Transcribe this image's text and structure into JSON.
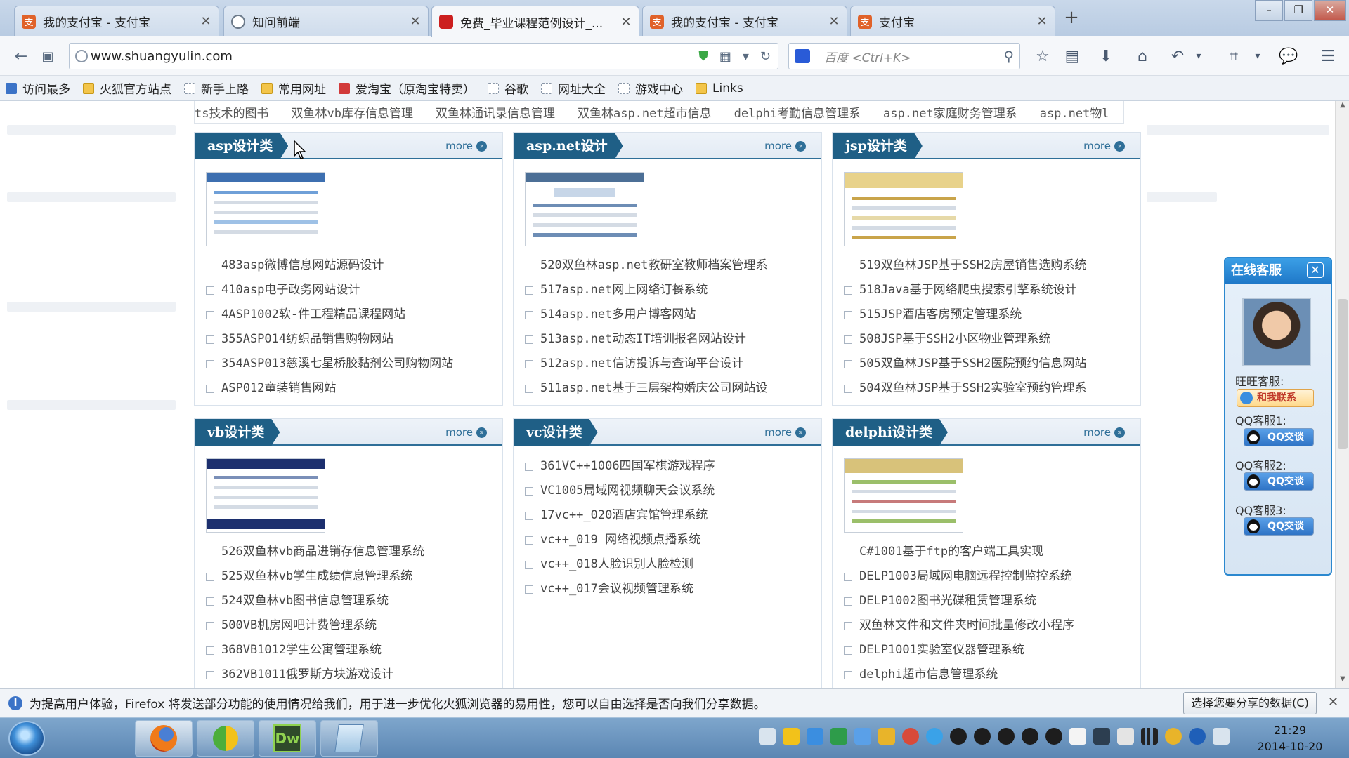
{
  "tabs": [
    {
      "title": "我的支付宝 - 支付宝",
      "icon": "alipay-icon",
      "color": "#e0622a"
    },
    {
      "title": "知问前端",
      "icon": "clock-icon",
      "color": "#6c7a8a"
    },
    {
      "title": "免费_毕业课程范例设计_...",
      "icon": "site-icon",
      "color": "#cc1f1f"
    },
    {
      "title": "我的支付宝 - 支付宝",
      "icon": "alipay-icon",
      "color": "#e0622a"
    },
    {
      "title": "支付宝",
      "icon": "alipay-icon",
      "color": "#e0622a"
    }
  ],
  "url": "www.shuangyulin.com",
  "search_placeholder": "百度 <Ctrl+K>",
  "bookmarks": [
    {
      "label": "访问最多",
      "icon": "blue"
    },
    {
      "label": "火狐官方站点",
      "icon": "folder"
    },
    {
      "label": "新手上路",
      "icon": "page"
    },
    {
      "label": "常用网址",
      "icon": "folder"
    },
    {
      "label": "爱淘宝（原淘宝特卖）",
      "icon": "red"
    },
    {
      "label": "谷歌",
      "icon": "page"
    },
    {
      "label": "网址大全",
      "icon": "page"
    },
    {
      "label": "游戏中心",
      "icon": "page"
    },
    {
      "label": "Links",
      "icon": "folder"
    }
  ],
  "marquee": [
    "ts技术的图书",
    "双鱼林vb库存信息管理",
    "双鱼林通讯录信息管理",
    "双鱼林asp.net超市信息",
    "delphi考勤信息管理系",
    "asp.net家庭财务管理系",
    "asp.net物l"
  ],
  "more_label": "more",
  "panels": [
    {
      "title": "asp设计类",
      "items": [
        "483asp微博信息网站源码设计",
        "410asp电子政务网站设计",
        "4ASP1002软-件工程精品课程网站",
        "355ASP014纺织品销售购物网站",
        "354ASP013慈溪七星桥胶黏剂公司购物网站",
        "ASP012童装销售网站"
      ]
    },
    {
      "title": "asp.net设计",
      "items": [
        "520双鱼林asp.net教研室教师档案管理系",
        "517asp.net网上网络订餐系统",
        "514asp.net多用户博客网站",
        "513asp.net动态IT培训报名网站设计",
        "512asp.net信访投诉与查询平台设计",
        "511asp.net基于三层架构婚庆公司网站设"
      ]
    },
    {
      "title": "jsp设计类",
      "items": [
        "519双鱼林JSP基于SSH2房屋销售选购系统",
        "518Java基于网络爬虫搜索引擎系统设计",
        "515JSP酒店客房预定管理系统",
        "508JSP基于SSH2小区物业管理系统",
        "505双鱼林JSP基于SSH2医院预约信息网站",
        "504双鱼林JSP基于SSH2实验室预约管理系"
      ]
    },
    {
      "title": "vb设计类",
      "items": [
        "526双鱼林vb商品进销存信息管理系统",
        "525双鱼林vb学生成绩信息管理系统",
        "524双鱼林vb图书信息管理系统",
        "500VB机房网吧计费管理系统",
        "368VB1012学生公寓管理系统",
        "362VB1011俄罗斯方块游戏设计"
      ]
    },
    {
      "title": "vc设计类",
      "items": [
        "361VC++1006四国军棋游戏程序",
        "VC1005局域网视频聊天会议系统",
        "17vc++_020酒店宾馆管理系统",
        "vc++_019 网络视频点播系统",
        "vc++_018人脸识别人脸检测",
        "vc++_017会议视频管理系统"
      ]
    },
    {
      "title": "delphi设计类",
      "items": [
        "C#1001基于ftp的客户端工具实现",
        "DELP1003局域网电脑远程控制监控系统",
        "DELP1002图书光碟租赁管理系统",
        "双鱼林文件和文件夹时间批量修改小程序",
        "DELP1001实验室仪器管理系统",
        "delphi超市信息管理系统"
      ]
    }
  ],
  "service": {
    "title": "在线客服",
    "wangwang_label": "旺旺客服:",
    "wangwang_button": "和我联系",
    "qq1_label": "QQ客服1:",
    "qq2_label": "QQ客服2:",
    "qq3_label": "QQ客服3:",
    "qq_button": "QQ交谈"
  },
  "notification": {
    "text": "为提高用户体验，Firefox 将发送部分功能的使用情况给我们，用于进一步优化火狐浏览器的易用性，您可以自由选择是否向我们分享数据。",
    "button": "选择您要分享的数据(C)"
  },
  "clock": {
    "time": "21:29",
    "date": "2014-10-20"
  },
  "taskbar_apps": [
    "firefox-icon",
    "sync-icon",
    "dreamweaver-icon",
    "notepad-icon"
  ],
  "dreamweaver_label": "Dw"
}
